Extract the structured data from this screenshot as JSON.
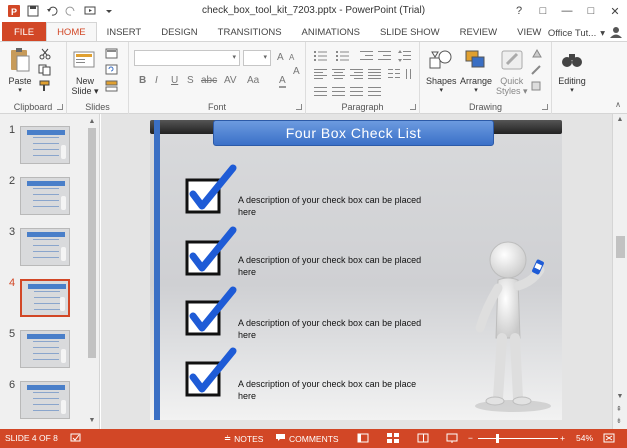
{
  "window": {
    "title": "check_box_tool_kit_7203.pptx - PowerPoint (Trial)",
    "controls": [
      "?",
      "□",
      "—",
      "□",
      "✕"
    ]
  },
  "tabs": {
    "file": "FILE",
    "items": [
      "HOME",
      "INSERT",
      "DESIGN",
      "TRANSITIONS",
      "ANIMATIONS",
      "SLIDE SHOW",
      "REVIEW",
      "VIEW"
    ],
    "active": "HOME",
    "account": "Office Tut..."
  },
  "ribbon": {
    "clipboard": {
      "label": "Clipboard",
      "paste": "Paste"
    },
    "slides": {
      "label": "Slides",
      "new_slide_1": "New",
      "new_slide_2": "Slide"
    },
    "font": {
      "label": "Font",
      "bold": "B",
      "italic": "I",
      "underline": "U",
      "shadow": "S",
      "strike": "abc",
      "spacing": "AV",
      "case": "Aa",
      "grow": "A",
      "shrink": "A",
      "clear": "A"
    },
    "paragraph": {
      "label": "Paragraph"
    },
    "drawing": {
      "label": "Drawing",
      "shapes": "Shapes",
      "arrange": "Arrange",
      "quick_styles_1": "Quick",
      "quick_styles_2": "Styles"
    },
    "editing": {
      "label": "Editing"
    }
  },
  "thumbnails": [
    {
      "num": "1"
    },
    {
      "num": "2"
    },
    {
      "num": "3"
    },
    {
      "num": "4",
      "selected": true
    },
    {
      "num": "5"
    },
    {
      "num": "6"
    }
  ],
  "slide": {
    "title": "Four Box Check List",
    "items": [
      "A description of your check box can be placed here",
      "A description of your check box can be placed here",
      "A description of your check box can be placed here",
      "A description of your check box can be place here"
    ],
    "accent": "#3a6fc4"
  },
  "statusbar": {
    "slide_info": "SLIDE 4 OF 8",
    "notes": "NOTES",
    "comments": "COMMENTS",
    "zoom_minus": "−",
    "zoom_plus": "+",
    "zoom": "54%",
    "color": "#d24726"
  }
}
